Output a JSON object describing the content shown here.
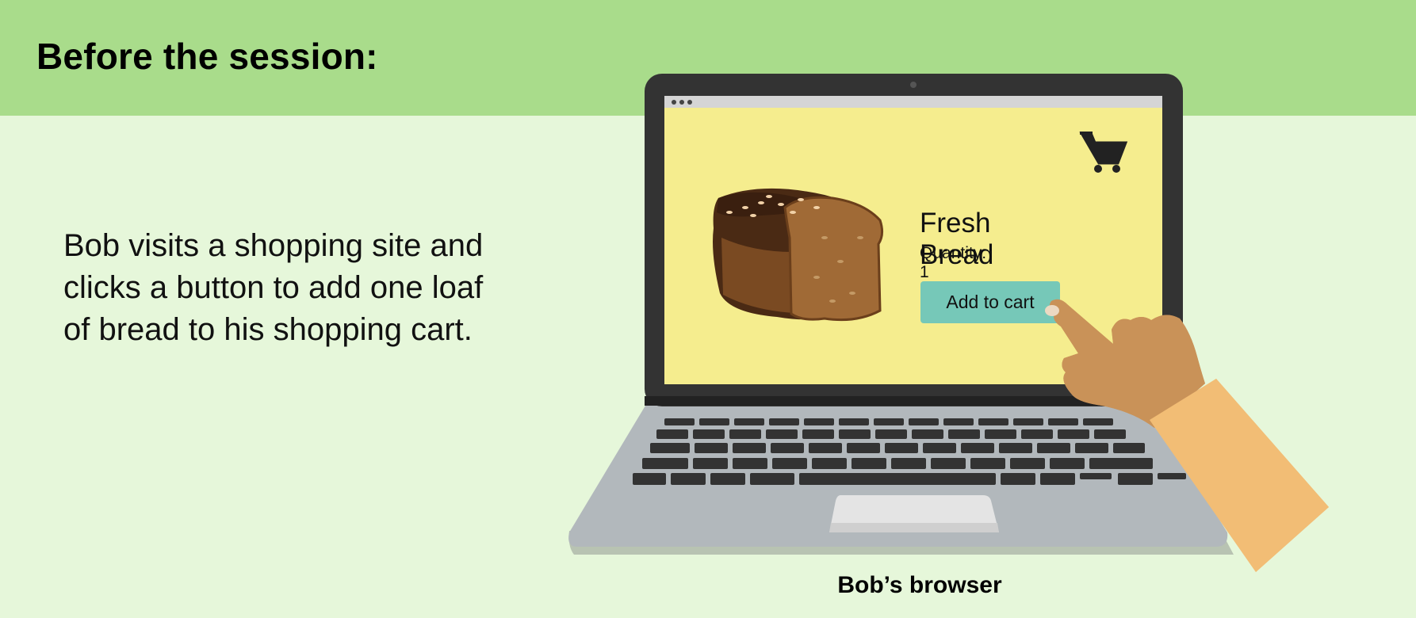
{
  "heading": "Before the session:",
  "description": "Bob visits a shopping site and clicks a button to add one loaf of bread to his shopping cart.",
  "screen": {
    "product_title": "Fresh Bread",
    "quantity": "Quantity: 1",
    "add_button": "Add to cart",
    "cart_icon": "shopping-cart-icon"
  },
  "caption": "Bob’s browser",
  "colors": {
    "header_band": "#a9dc8b",
    "background": "#e6f7da",
    "screen": "#f5ed8e",
    "button": "#76c8b8",
    "laptop_frame": "#333333",
    "laptop_base": "#b2b8bc",
    "skin": "#c99258",
    "sleeve": "#f2bd75"
  }
}
